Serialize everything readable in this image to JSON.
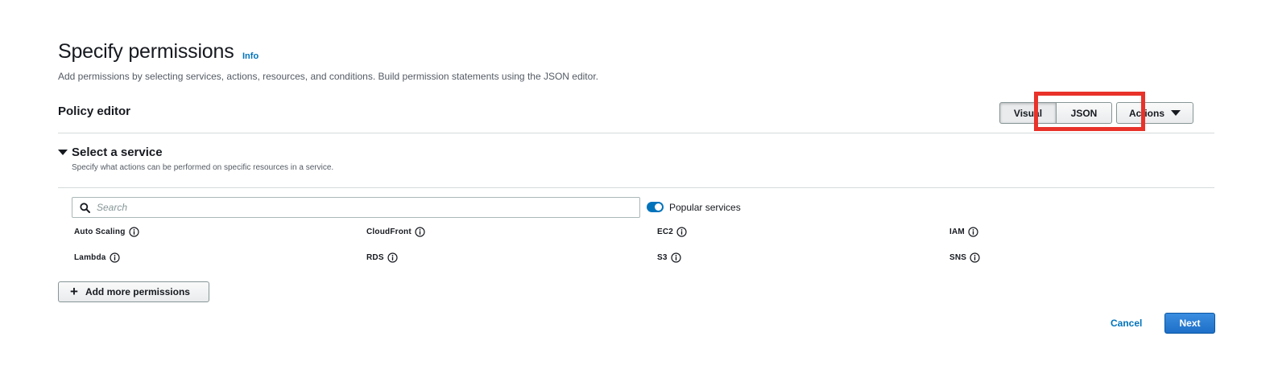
{
  "header": {
    "title": "Specify permissions",
    "info_link": "Info",
    "description": "Add permissions by selecting services, actions, resources, and conditions. Build permission statements using the JSON editor."
  },
  "policy_editor": {
    "title": "Policy editor",
    "tabs": [
      {
        "label": "Visual",
        "selected": true
      },
      {
        "label": "JSON",
        "selected": false
      }
    ],
    "actions_label": "Actions",
    "highlight_color": "#e8322a"
  },
  "section": {
    "title": "Select a service",
    "description": "Specify what actions can be performed on specific resources in a service.",
    "expanded": true
  },
  "search": {
    "placeholder": "Search",
    "value": ""
  },
  "popular_toggle": {
    "label": "Popular services",
    "on": true
  },
  "services": [
    "Auto Scaling",
    "CloudFront",
    "EC2",
    "IAM",
    "Lambda",
    "RDS",
    "S3",
    "SNS"
  ],
  "add_permissions_label": "Add more permissions",
  "footer": {
    "cancel_label": "Cancel",
    "next_label": "Next"
  },
  "colors": {
    "accent": "#0073bb",
    "primary_button": "#1e6fc8",
    "highlight": "#e8322a"
  },
  "icons": [
    "info-circle-icon",
    "search-icon",
    "caret-down-icon",
    "plus-icon"
  ]
}
